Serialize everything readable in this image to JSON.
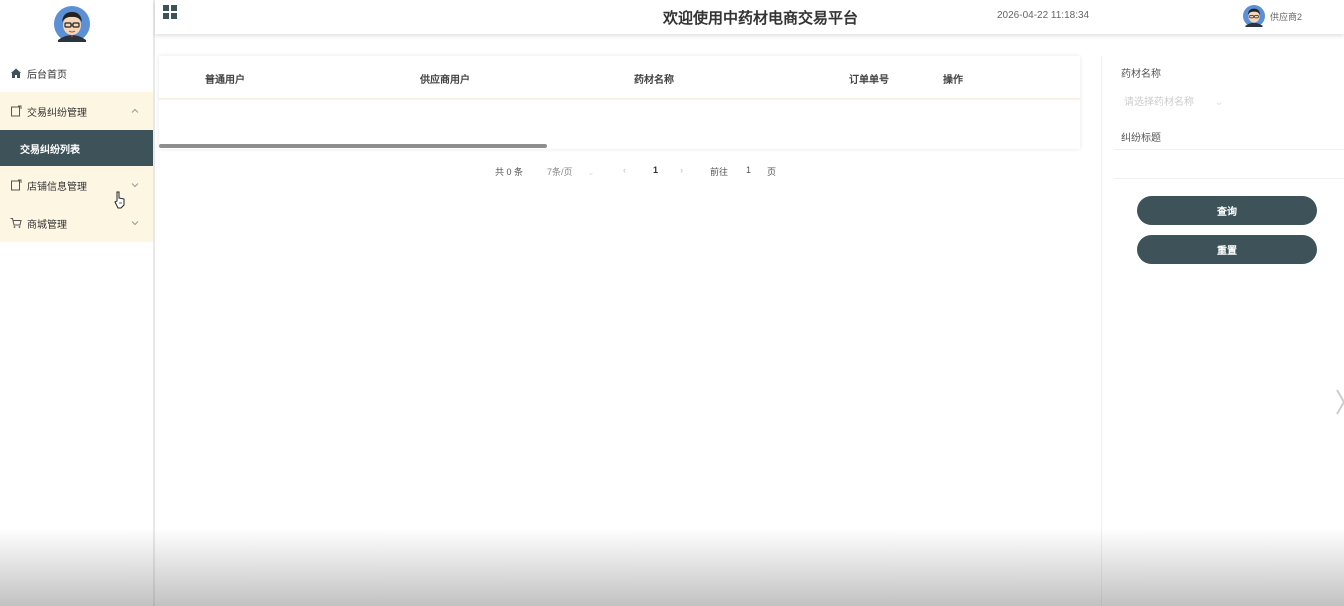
{
  "header": {
    "title": "欢迎使用中药材电商交易平台",
    "datetime": "2026-04-22 11:18:34",
    "username": "供应商2"
  },
  "sidebar": {
    "items": [
      {
        "label": "后台首页",
        "icon": "home-icon"
      },
      {
        "label": "交易纠纷管理",
        "icon": "document-icon",
        "expanded": true,
        "children": [
          {
            "label": "交易纠纷列表",
            "active": true
          }
        ]
      },
      {
        "label": "店铺信息管理",
        "icon": "document-icon",
        "expanded": false
      },
      {
        "label": "商城管理",
        "icon": "cart-icon",
        "expanded": false
      }
    ]
  },
  "table": {
    "columns": [
      "普通用户",
      "供应商用户",
      "药材名称",
      "订单单号",
      "操作"
    ],
    "rows": []
  },
  "pagination": {
    "total_text": "共 0 条",
    "page_size": "7条/页",
    "current_page": "1",
    "goto_label": "前往",
    "goto_value": "1",
    "page_suffix": "页"
  },
  "search": {
    "herb_name_label": "药材名称",
    "herb_name_placeholder": "请选择药材名称",
    "dispute_title_label": "纠纷标题",
    "dispute_title_value": "",
    "query_button": "查询",
    "reset_button": "重置"
  },
  "colors": {
    "accent": "#3d5259",
    "group_bg": "#fdf6e3"
  }
}
